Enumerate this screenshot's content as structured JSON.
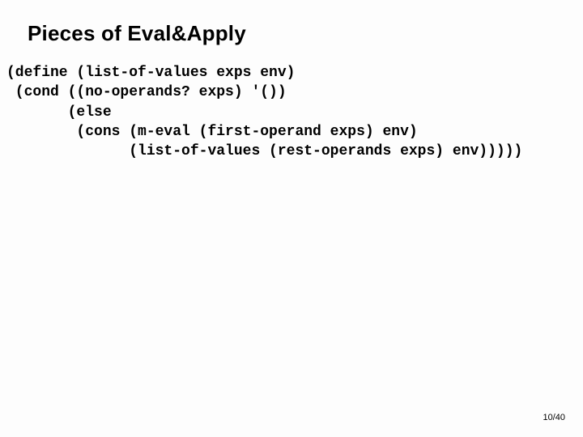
{
  "title": "Pieces of Eval&Apply",
  "code": {
    "l1": "(define (list-of-values exps env)",
    "l2": " (cond ((no-operands? exps) '())",
    "l3": "       (else",
    "l4": "        (cons (m-eval (first-operand exps) env)",
    "l5": "              (list-of-values (rest-operands exps) env)))))"
  },
  "page": "10/40"
}
